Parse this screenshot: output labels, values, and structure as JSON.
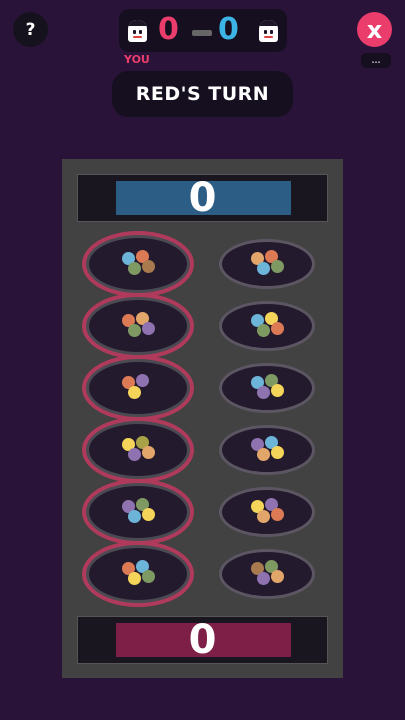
{
  "header": {
    "help_label": "?",
    "close_label": "x",
    "more_label": "...",
    "you_label": "YOU",
    "turn_text": "RED'S TURN"
  },
  "scoreboard": {
    "red_score": "0",
    "blue_score": "0"
  },
  "colors": {
    "background": "#2a1339",
    "red": "#ea3d6c",
    "blue": "#3db4e6",
    "board": "#424242",
    "blue_store": "#2b5d85",
    "red_store": "#7e1f48"
  },
  "board": {
    "blue_store_count": "0",
    "red_store_count": "0",
    "red_pits": [
      {
        "seeds": [
          "blue",
          "orange",
          "green",
          "brown"
        ]
      },
      {
        "seeds": [
          "orange",
          "peach",
          "green",
          "purple"
        ]
      },
      {
        "seeds": [
          "orange",
          "purple",
          "yellow"
        ]
      },
      {
        "seeds": [
          "yellow",
          "olive",
          "purple",
          "peach"
        ]
      },
      {
        "seeds": [
          "purple",
          "green",
          "blue",
          "yellow"
        ]
      },
      {
        "seeds": [
          "orange",
          "blue",
          "yellow",
          "green"
        ]
      }
    ],
    "blue_pits": [
      {
        "seeds": [
          "peach",
          "orange",
          "blue",
          "green"
        ]
      },
      {
        "seeds": [
          "blue",
          "yellow",
          "green",
          "orange"
        ]
      },
      {
        "seeds": [
          "blue",
          "green",
          "purple",
          "yellow"
        ]
      },
      {
        "seeds": [
          "purple",
          "blue",
          "peach",
          "yellow"
        ]
      },
      {
        "seeds": [
          "yellow",
          "purple",
          "peach",
          "orange"
        ]
      },
      {
        "seeds": [
          "brown",
          "green",
          "purple",
          "peach"
        ]
      }
    ]
  }
}
